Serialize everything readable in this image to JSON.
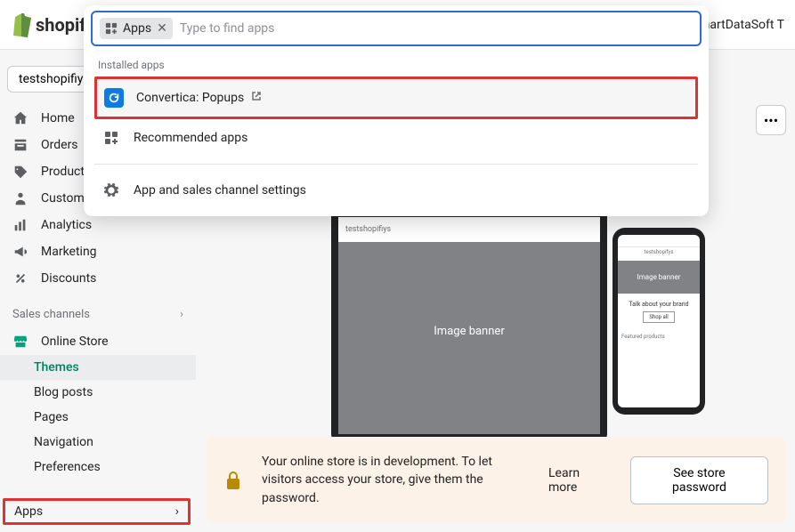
{
  "header": {
    "logo_text": "shopify",
    "right_text": "SmartDataSoft T"
  },
  "sidebar": {
    "store_name": "testshopifiys",
    "items": [
      {
        "label": "Home"
      },
      {
        "label": "Orders"
      },
      {
        "label": "Products"
      },
      {
        "label": "Custome"
      },
      {
        "label": "Analytics"
      },
      {
        "label": "Marketing"
      },
      {
        "label": "Discounts"
      }
    ],
    "sales_channels_label": "Sales channels",
    "online_store_label": "Online Store",
    "subitems": [
      {
        "label": "Themes"
      },
      {
        "label": "Blog posts"
      },
      {
        "label": "Pages"
      },
      {
        "label": "Navigation"
      },
      {
        "label": "Preferences"
      }
    ],
    "apps_label": "Apps"
  },
  "popover": {
    "chip_label": "Apps",
    "placeholder": "Type to find apps",
    "installed_label": "Installed apps",
    "installed_app": "Convertica: Popups",
    "recommended_label": "Recommended apps",
    "settings_label": "App and sales channel settings"
  },
  "preview": {
    "desktop_title": "testshopifiys",
    "desktop_banner": "Image banner",
    "phone_title": "testshopifys",
    "phone_banner": "Image banner",
    "phone_talk": "Talk about your brand",
    "phone_featured": "Featured products"
  },
  "dev_banner": {
    "message": "Your online store is in development. To let visitors access your store, give them the password.",
    "learn_more": "Learn more",
    "button": "See store password"
  }
}
